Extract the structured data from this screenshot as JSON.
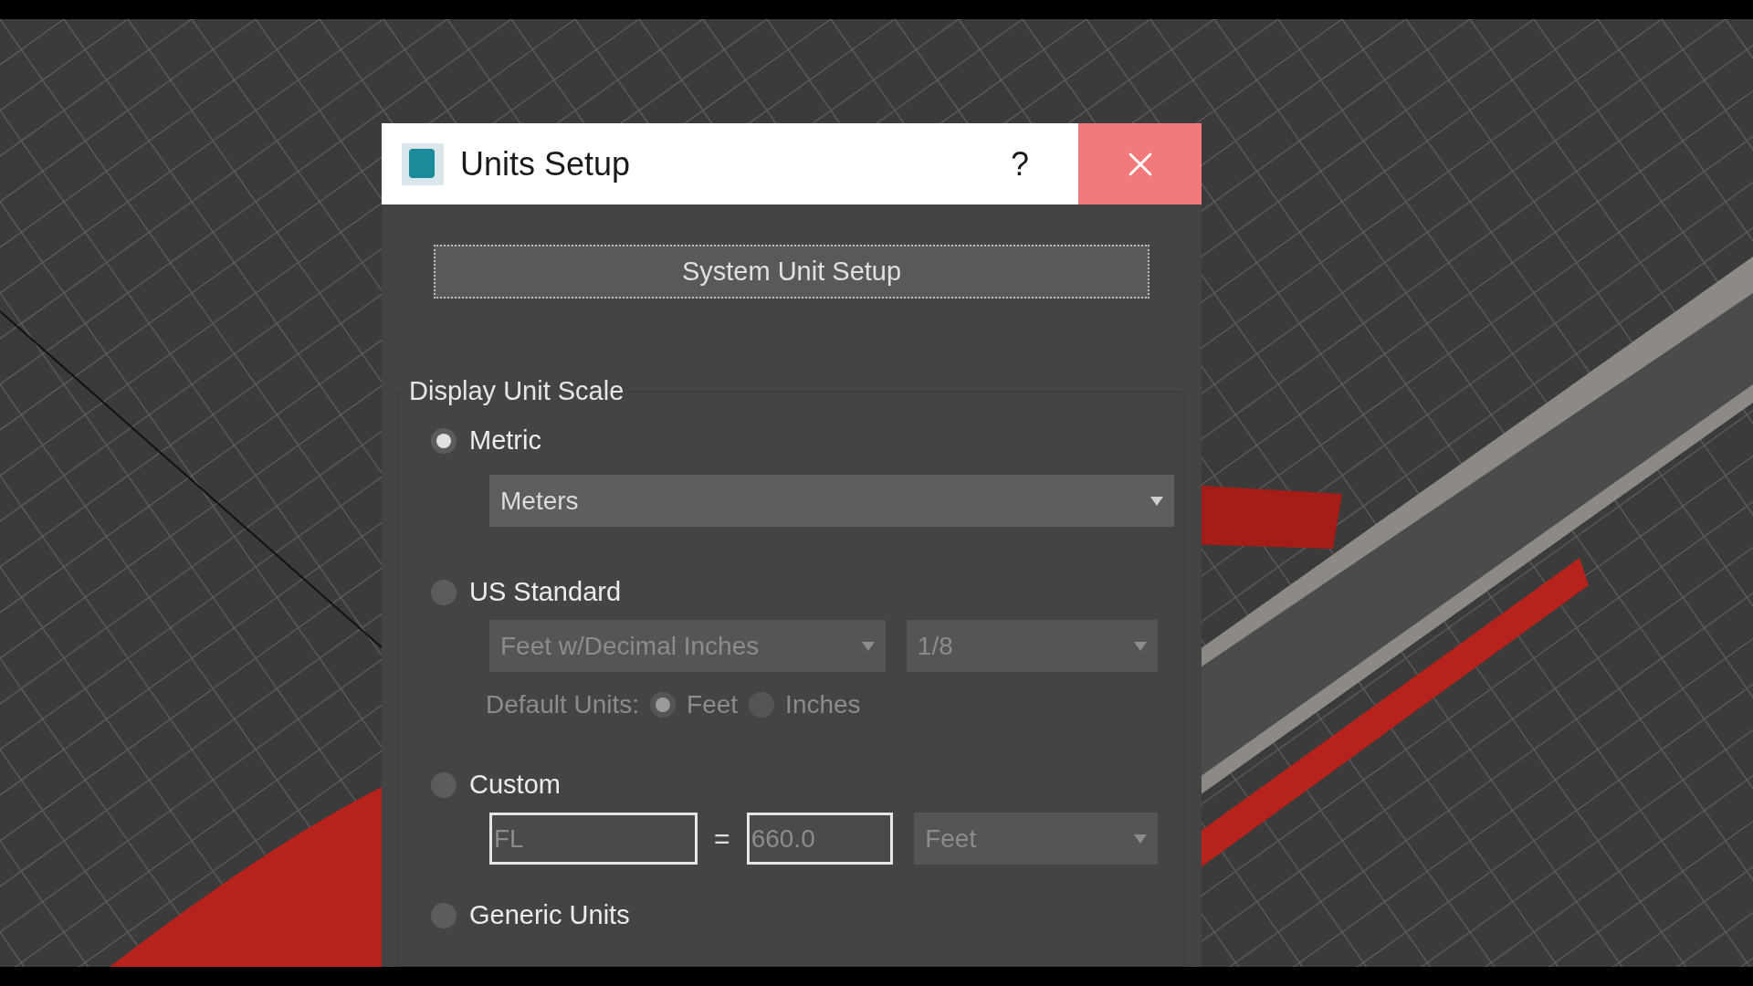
{
  "window": {
    "title": "Units Setup",
    "help": "?"
  },
  "system_unit_setup_button": {
    "label": "System Unit Setup"
  },
  "display_unit_scale": {
    "label": "Display Unit Scale",
    "options": [
      {
        "kind": "metric",
        "label": "Metric",
        "selected": true,
        "dropdowns": [
          {
            "value": "Meters",
            "disabled": false
          }
        ]
      },
      {
        "kind": "us_standard",
        "label": "US Standard",
        "selected": false,
        "dropdowns": [
          {
            "value": "Feet w/Decimal Inches",
            "disabled": true
          },
          {
            "value": "1/8",
            "disabled": true
          }
        ],
        "default_units": {
          "label": "Default Units:",
          "disabled": true,
          "options": [
            {
              "label": "Feet",
              "selected": true
            },
            {
              "label": "Inches",
              "selected": false
            }
          ]
        }
      },
      {
        "kind": "custom",
        "label": "Custom",
        "selected": false,
        "fields": [
          {
            "value": "FL",
            "disabled": true
          },
          {
            "value": "660.0",
            "disabled": true
          }
        ],
        "equals": "=",
        "dropdowns": [
          {
            "value": "Feet",
            "disabled": true
          }
        ]
      },
      {
        "kind": "generic",
        "label": "Generic Units",
        "selected": false
      }
    ]
  }
}
